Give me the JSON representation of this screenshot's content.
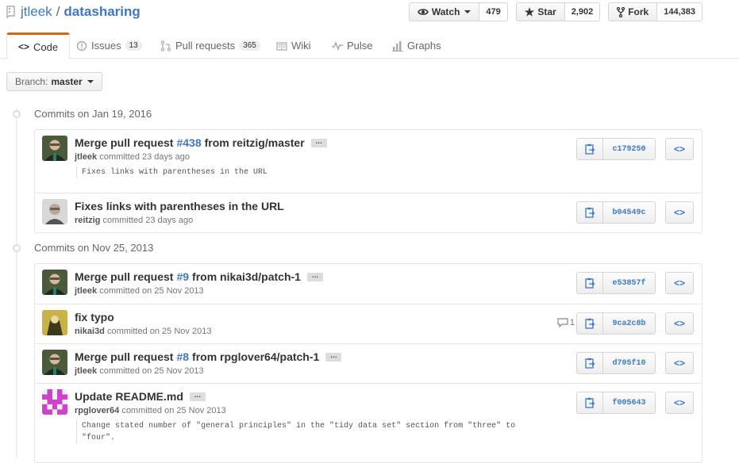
{
  "repo": {
    "owner": "jtleek",
    "separator": "/",
    "name": "datasharing"
  },
  "actions": {
    "watch": {
      "label": "Watch",
      "count": "479"
    },
    "star": {
      "label": "Star",
      "count": "2,902"
    },
    "fork": {
      "label": "Fork",
      "count": "144,383"
    }
  },
  "tabs": [
    {
      "label": "Code",
      "icon": "code-icon"
    },
    {
      "label": "Issues",
      "count": "13",
      "icon": "issue-icon"
    },
    {
      "label": "Pull requests",
      "count": "365",
      "icon": "pull-request-icon"
    },
    {
      "label": "Wiki",
      "icon": "book-icon"
    },
    {
      "label": "Pulse",
      "icon": "pulse-icon"
    },
    {
      "label": "Graphs",
      "icon": "graph-icon"
    }
  ],
  "branch": {
    "prefix": "Branch:",
    "name": "master"
  },
  "groups": [
    {
      "title": "Commits on Jan 19, 2016",
      "commits": [
        {
          "title_prefix": "Merge pull request",
          "pr": "#438",
          "title_suffix": "from reitzig/master",
          "has_ellipsis": true,
          "author": "jtleek",
          "meta": "committed 23 days ago",
          "description": "Fixes links with parentheses in the URL",
          "sha": "c179250",
          "avatar": "avatar-jtleek"
        },
        {
          "title_prefix": "Fixes links with parentheses in the URL",
          "pr": "",
          "title_suffix": "",
          "has_ellipsis": false,
          "author": "reitzig",
          "meta": "committed 23 days ago",
          "description": "",
          "sha": "b04549c",
          "avatar": "avatar-reitzig"
        }
      ]
    },
    {
      "title": "Commits on Nov 25, 2013",
      "commits": [
        {
          "title_prefix": "Merge pull request",
          "pr": "#9",
          "title_suffix": "from nikai3d/patch-1",
          "has_ellipsis": true,
          "author": "jtleek",
          "meta": "committed on 25 Nov 2013",
          "description": "",
          "sha": "e53857f",
          "avatar": "avatar-jtleek"
        },
        {
          "title_prefix": "fix typo",
          "pr": "",
          "title_suffix": "",
          "has_ellipsis": false,
          "author": "nikai3d",
          "meta": "committed on 25 Nov 2013",
          "description": "",
          "sha": "9ca2c8b",
          "comments": "1",
          "avatar": "avatar-nikai3d"
        },
        {
          "title_prefix": "Merge pull request",
          "pr": "#8",
          "title_suffix": "from rpglover64/patch-1",
          "has_ellipsis": true,
          "author": "jtleek",
          "meta": "committed on 25 Nov 2013",
          "description": "",
          "sha": "d705f10",
          "avatar": "avatar-jtleek"
        },
        {
          "title_prefix": "Update README.md",
          "pr": "",
          "title_suffix": "",
          "has_ellipsis": true,
          "author": "rpglover64",
          "meta": "committed on 25 Nov 2013",
          "description": "Change stated number of \"general principles\" in the \"tidy data set\" section from \"three\" to\n\"four\".",
          "sha": "f005643",
          "avatar": "avatar-rpglover64"
        }
      ]
    }
  ],
  "ellipsis_text": "…",
  "browse_glyph": "<>",
  "colors": {
    "link": "#4078c0",
    "tab_accent": "#d26911",
    "identicon": "#cc44cc"
  }
}
